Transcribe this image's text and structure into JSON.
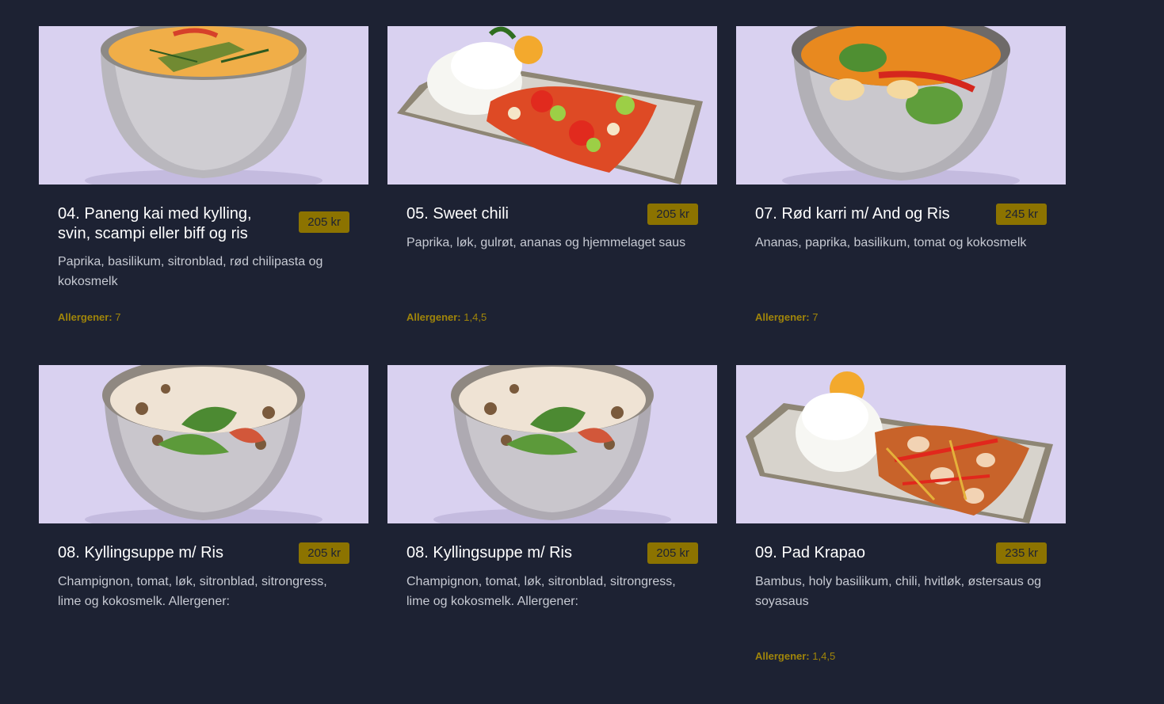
{
  "colors": {
    "background": "#1d2233",
    "price_badge": "#8c7300",
    "allergen_text": "#a0850a",
    "photo_backdrop": "#d8d0ef"
  },
  "allergen_label": "Allergener:",
  "dishes": [
    {
      "title": "04. Paneng kai med kylling, svin, scampi eller biff og ris",
      "price": "205 kr",
      "description": "Paprika, basilikum, sitronblad, rød chilipasta og kokosmelk",
      "allergens": "7",
      "image": "bowl-orange-curry"
    },
    {
      "title": "05. Sweet chili",
      "price": "205 kr",
      "description": "Paprika, løk, gulrøt, ananas og hjemmelaget saus",
      "allergens": "1,4,5",
      "image": "plate-sweet-chili-rice"
    },
    {
      "title": "07. Rød karri m/ And og Ris",
      "price": "245 kr",
      "description": "Ananas, paprika, basilikum, tomat og kokosmelk",
      "allergens": "7",
      "image": "bowl-red-curry"
    },
    {
      "title": "08. Kyllingsuppe m/ Ris",
      "price": "205 kr",
      "description": "Champignon, tomat, løk, sitronblad, sitrongress, lime og kokosmelk. Allergener:",
      "allergens": "",
      "image": "bowl-coconut-soup"
    },
    {
      "title": "08. Kyllingsuppe m/ Ris",
      "price": "205 kr",
      "description": "Champignon, tomat, løk, sitronblad, sitrongress, lime og kokosmelk. Allergener:",
      "allergens": "",
      "image": "bowl-coconut-soup"
    },
    {
      "title": "09. Pad Krapao",
      "price": "235 kr",
      "description": "Bambus, holy basilikum, chili, hvitløk, østersaus og soyasaus",
      "allergens": "1,4,5",
      "image": "plate-pad-krapao-rice"
    }
  ]
}
